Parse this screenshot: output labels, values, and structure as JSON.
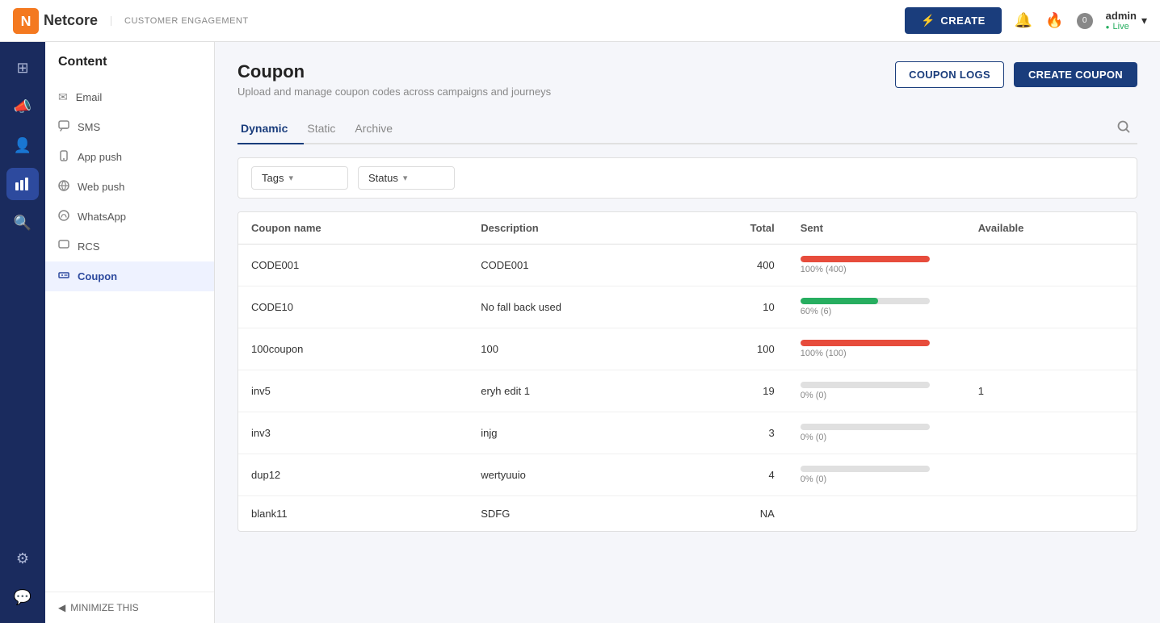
{
  "header": {
    "logo_text": "Netcore",
    "customer_engagement": "CUSTOMER ENGAGEMENT",
    "create_label": "CREATE",
    "admin_name": "admin",
    "admin_status": "Live",
    "notif_count": "0"
  },
  "icon_sidebar": {
    "items": [
      {
        "name": "grid-icon",
        "symbol": "⊞",
        "active": false
      },
      {
        "name": "megaphone-icon",
        "symbol": "📣",
        "active": false
      },
      {
        "name": "users-icon",
        "symbol": "👥",
        "active": false
      },
      {
        "name": "chart-icon",
        "symbol": "📊",
        "active": true
      },
      {
        "name": "search-analytics-icon",
        "symbol": "🔍",
        "active": false
      }
    ],
    "bottom_items": [
      {
        "name": "settings-icon",
        "symbol": "⚙"
      },
      {
        "name": "support-icon",
        "symbol": "💬"
      }
    ]
  },
  "nav_sidebar": {
    "title": "Content",
    "items": [
      {
        "name": "email",
        "label": "Email",
        "icon": "✉"
      },
      {
        "name": "sms",
        "label": "SMS",
        "icon": "💬"
      },
      {
        "name": "app-push",
        "label": "App push",
        "icon": "📱"
      },
      {
        "name": "web-push",
        "label": "Web push",
        "icon": "🌐"
      },
      {
        "name": "whatsapp",
        "label": "WhatsApp",
        "icon": "💬"
      },
      {
        "name": "rcs",
        "label": "RCS",
        "icon": "💬"
      },
      {
        "name": "coupon",
        "label": "Coupon",
        "icon": "🏷",
        "active": true
      }
    ],
    "minimize_label": "MINIMIZE THIS"
  },
  "page": {
    "title": "Coupon",
    "subtitle": "Upload and manage coupon codes across campaigns and journeys",
    "coupon_logs_label": "COUPON LOGS",
    "create_coupon_label": "CREATE COUPON"
  },
  "tabs": [
    {
      "label": "Dynamic",
      "active": true
    },
    {
      "label": "Static",
      "active": false
    },
    {
      "label": "Archive",
      "active": false
    }
  ],
  "filters": {
    "tags_label": "Tags",
    "status_label": "Status"
  },
  "table": {
    "columns": [
      "Coupon name",
      "Description",
      "Total",
      "Sent",
      "Available"
    ],
    "rows": [
      {
        "name": "CODE001",
        "description": "CODE001",
        "total": "400",
        "sent_pct": 100,
        "sent_label": "100% (400)",
        "sent_color": "#e74c3c",
        "avail": ""
      },
      {
        "name": "CODE10",
        "description": "No fall back used",
        "total": "10",
        "sent_pct": 60,
        "sent_label": "60% (6)",
        "sent_color": "#27ae60",
        "avail": ""
      },
      {
        "name": "100coupon",
        "description": "100",
        "total": "100",
        "sent_pct": 100,
        "sent_label": "100% (100)",
        "sent_color": "#e74c3c",
        "avail": ""
      },
      {
        "name": "inv5",
        "description": "eryh edit 1",
        "total": "19",
        "sent_pct": 0,
        "sent_label": "0% (0)",
        "sent_color": "#ccc",
        "avail": "1"
      },
      {
        "name": "inv3",
        "description": "injg",
        "total": "3",
        "sent_pct": 0,
        "sent_label": "0% (0)",
        "sent_color": "#ccc",
        "avail": ""
      },
      {
        "name": "dup12",
        "description": "wertyuuio",
        "total": "4",
        "sent_pct": 0,
        "sent_label": "0% (0)",
        "sent_color": "#ccc",
        "avail": ""
      },
      {
        "name": "blank11",
        "description": "SDFG",
        "total": "NA",
        "sent_pct": 0,
        "sent_label": "",
        "sent_color": "#ccc",
        "avail": ""
      }
    ]
  },
  "colors": {
    "primary": "#1a3d7c",
    "active_nav": "#2d4a9e",
    "sidebar_bg": "#1a2b5e"
  }
}
